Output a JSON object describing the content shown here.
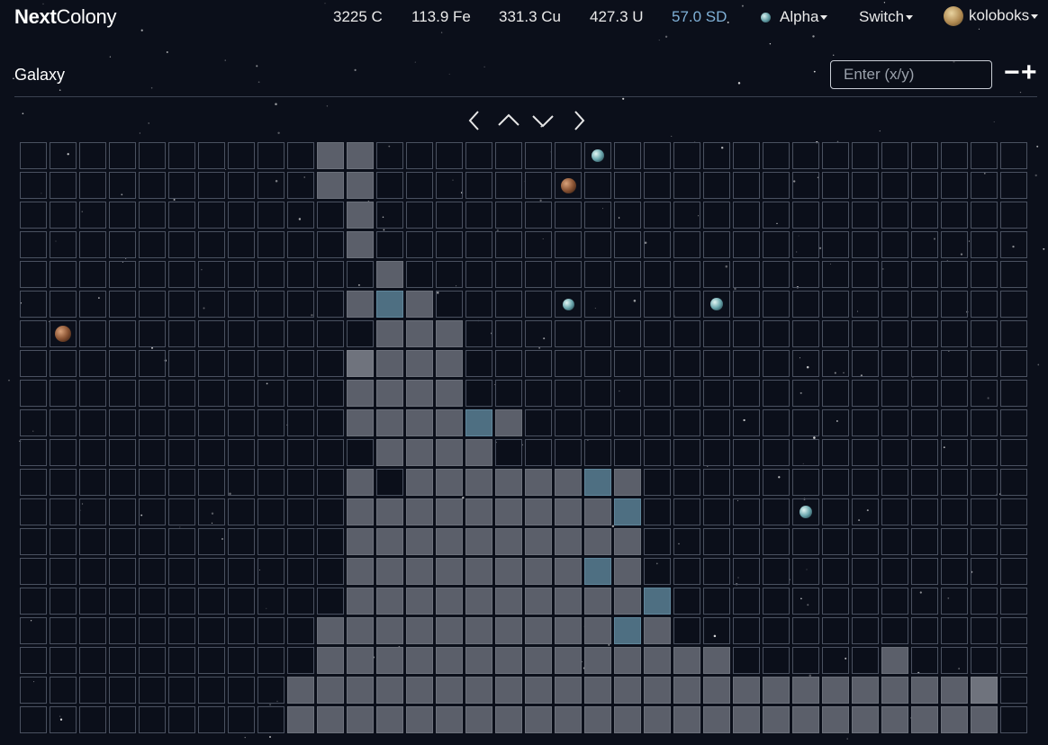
{
  "brand": {
    "bold": "Next",
    "light": "Colony"
  },
  "resources": {
    "coal": "3225 C",
    "iron": "113.9 Fe",
    "copper": "331.3 Cu",
    "uranium": "427.3 U",
    "sd": "57.0 SD"
  },
  "colors": {
    "sd": "#7fb0d6",
    "tile_filled": "#5b5f6a",
    "tile_highlight": "#4e6f82",
    "grid_line": "#4a5160",
    "background": "#0b0f1a"
  },
  "planet_menu": {
    "label": "Alpha",
    "icon": "planet-icon"
  },
  "switch_menu": {
    "label": "Switch"
  },
  "user_menu": {
    "label": "koloboks",
    "icon": "avatar"
  },
  "page": {
    "title": "Galaxy"
  },
  "search": {
    "placeholder": "Enter (x/y)"
  },
  "zoom": {
    "out_label": "−",
    "in_label": "+"
  },
  "navigation": {
    "icons": [
      "chevron-left-icon",
      "chevron-up-icon",
      "chevron-down-icon",
      "chevron-right-icon"
    ]
  },
  "map": {
    "columns": 34,
    "rows": 20,
    "tiles": [
      "..........FF......................",
      "..........FF......................",
      "...........F......................",
      "...........F......................",
      "............F.....................",
      "...........FBF....................",
      "............FFF...................",
      "...........LFFF...................",
      "...........FFFF...................",
      "...........FFFFBF.................",
      "............FFFF..................",
      "...........F.FFFFFFBF.............",
      "...........FFFFFFFFFB.............",
      "...........FFFFFFFFFF.............",
      "...........FFFFFFFFBF.............",
      "...........FFFFFFFFFFB............",
      "..........FFFFFFFFFFBF............",
      "..........FFFFFFFFFFFFFF.....F....",
      ".........FFFFFFFFFFFFFFFFFFFFFFFL.",
      ".........FFFFFFFFFFFFFFFFFFFFFFFF."
    ],
    "planets": [
      {
        "col": 19,
        "row": 0,
        "type": "blue",
        "size": 14
      },
      {
        "col": 18,
        "row": 1,
        "type": "brown",
        "size": 17
      },
      {
        "col": 18,
        "row": 5,
        "type": "blue",
        "size": 13
      },
      {
        "col": 23,
        "row": 5,
        "type": "blue",
        "size": 14
      },
      {
        "col": 1,
        "row": 6,
        "type": "brown",
        "size": 18
      },
      {
        "col": 26,
        "row": 12,
        "type": "blue",
        "size": 14
      }
    ]
  }
}
